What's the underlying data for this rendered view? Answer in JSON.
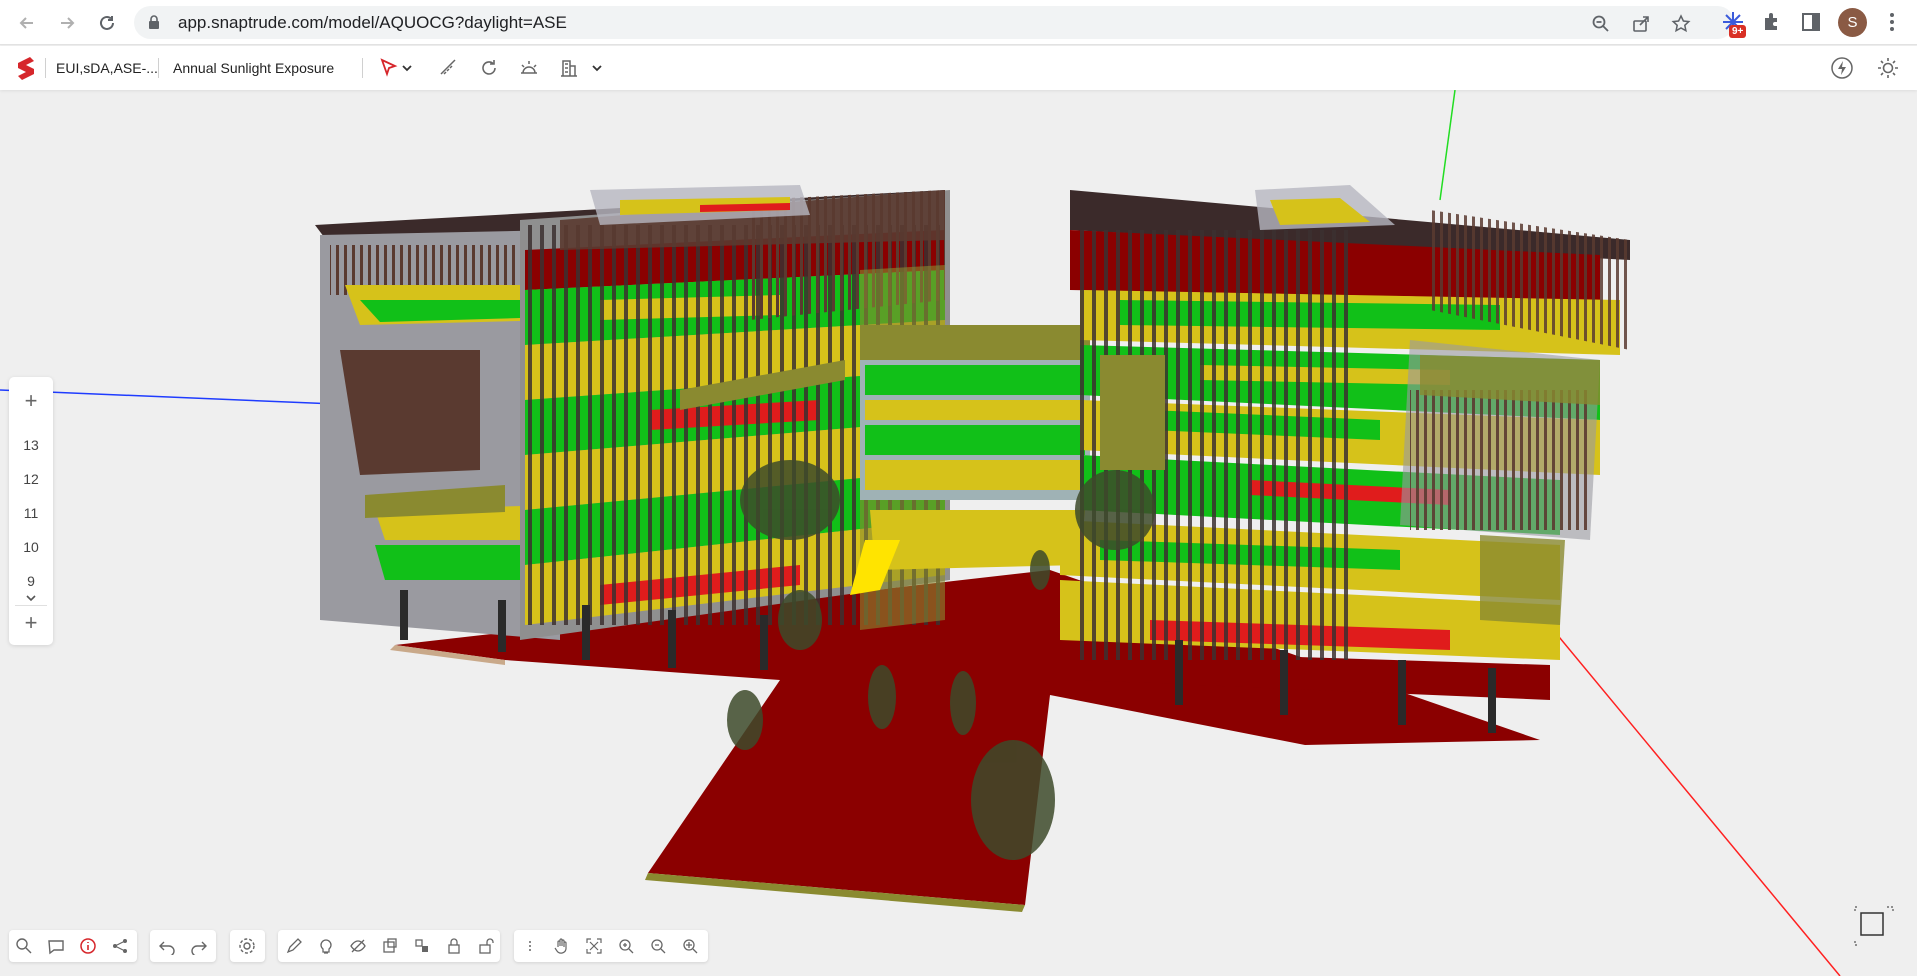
{
  "browser": {
    "url": "app.snaptrude.com/model/AQUOCG?daylight=ASE",
    "extension_badge": "9+",
    "profile_initial": "S",
    "icons": [
      "back-icon",
      "forward-icon",
      "reload-icon",
      "lock-icon",
      "zoom-icon",
      "share-icon",
      "bookmark-star-icon",
      "extension-puzzle-icon",
      "side-panel-icon",
      "menu-dots-icon"
    ]
  },
  "app": {
    "project_name": "EUI,sDA,ASE-...",
    "analysis_mode": "Annual Sunlight Exposure",
    "toolbar_icons": [
      "select-pointer-icon",
      "chevron-down-icon",
      "measure-icon",
      "rotate-icon",
      "sun-study-icon",
      "storey-icon",
      "chevron-down-icon"
    ],
    "right_icons": [
      "lightning-icon",
      "sun-settings-icon"
    ]
  },
  "storeys": {
    "add_label": "+",
    "items": [
      "13",
      "12",
      "11",
      "10",
      "9"
    ]
  },
  "bottom_toolbar": {
    "groups": [
      [
        "search-model-icon",
        "comment-icon",
        "info-icon",
        "share-icon"
      ],
      [
        "undo-icon",
        "redo-icon"
      ],
      [
        "settings-gear-icon"
      ],
      [
        "pen-draw-icon",
        "light-bulb-icon",
        "hide-icon",
        "isolate-icon",
        "layers-icon",
        "lock-icon",
        "unlock-icon"
      ],
      [
        "more-vertical-icon",
        "pan-hand-icon",
        "fit-view-icon",
        "zoom-in-icon",
        "zoom-out-icon",
        "zoom-extent-icon"
      ]
    ]
  },
  "colors": {
    "ase_high": "#8b0000",
    "ase_mid": "#e01c1c",
    "ase_low": "#d6c21a",
    "ase_none": "#11c018",
    "accent": "#d6262b",
    "canvas_bg": "#efefef"
  }
}
